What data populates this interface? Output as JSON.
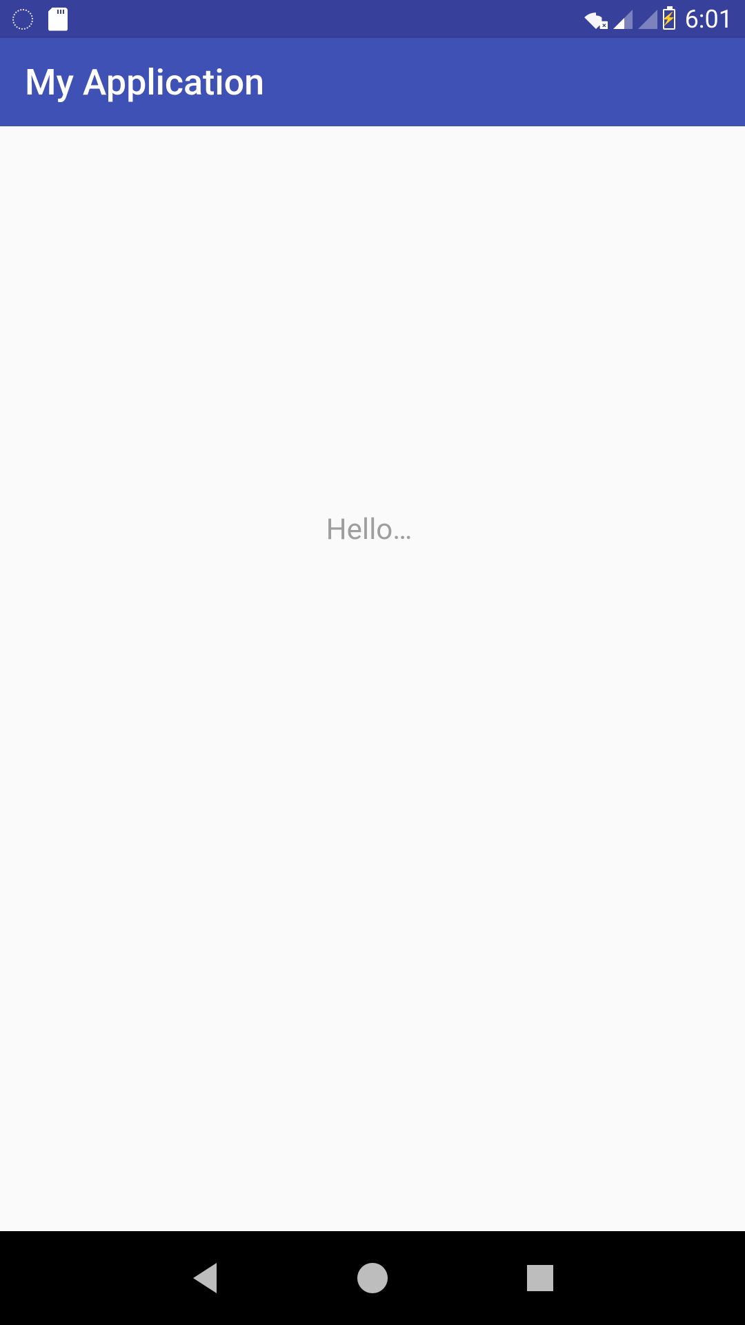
{
  "status_bar": {
    "clock": "6:01"
  },
  "app_bar": {
    "title": "My Application"
  },
  "content": {
    "hello_text": "Hello…"
  }
}
